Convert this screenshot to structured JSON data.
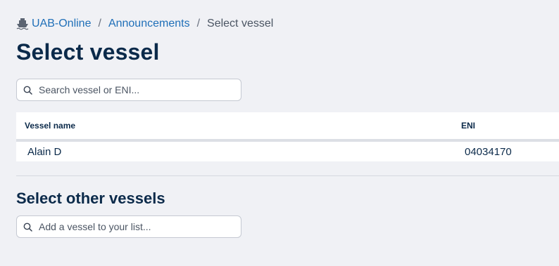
{
  "breadcrumb": {
    "icon": "ship-icon",
    "items": [
      "UAB-Online",
      "Announcements"
    ],
    "separator": "/",
    "current": "Select vessel"
  },
  "page_title": "Select vessel",
  "search": {
    "placeholder": "Search vessel or ENI..."
  },
  "table": {
    "headers": {
      "name": "Vessel name",
      "eni": "ENI"
    },
    "rows": [
      {
        "name": "Alain D",
        "eni": "04034170"
      }
    ]
  },
  "other_section": {
    "title": "Select other vessels",
    "placeholder": "Add a vessel to your list..."
  },
  "colors": {
    "link": "#1f6fb8",
    "heading": "#0b2a4a",
    "background": "#f0f1f5"
  }
}
